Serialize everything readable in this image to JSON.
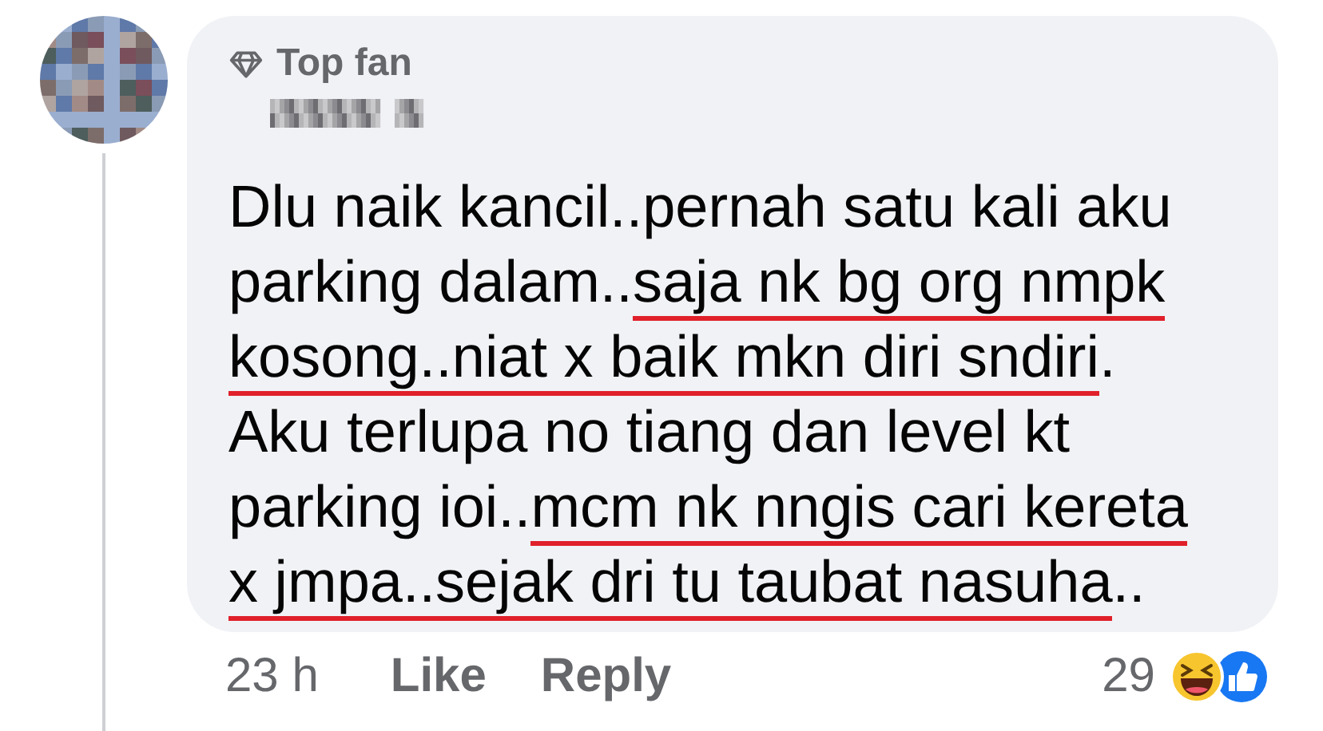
{
  "comment": {
    "badge": "Top fan",
    "lines": [
      [
        {
          "text": "Dlu naik kancil..pernah satu kali aku",
          "underlined": false
        }
      ],
      [
        {
          "text": "parking dalam..",
          "underlined": false
        },
        {
          "text": "saja nk bg org nmpk",
          "underlined": true
        }
      ],
      [
        {
          "text": "kosong..niat x baik mkn diri sndiri",
          "underlined": true
        },
        {
          "text": ".",
          "underlined": false
        }
      ],
      [
        {
          "text": "Aku terlupa no tiang dan level kt",
          "underlined": false
        }
      ],
      [
        {
          "text": "parking ioi..",
          "underlined": false
        },
        {
          "text": "mcm nk nngis cari kereta",
          "underlined": true
        }
      ],
      [
        {
          "text": "x jmpa..sejak dri tu taubat nasuha",
          "underlined": true
        },
        {
          "text": "..",
          "underlined": false
        }
      ]
    ],
    "time": "23 h",
    "actions": [
      "Like",
      "Reply"
    ],
    "reaction_count": "29"
  }
}
